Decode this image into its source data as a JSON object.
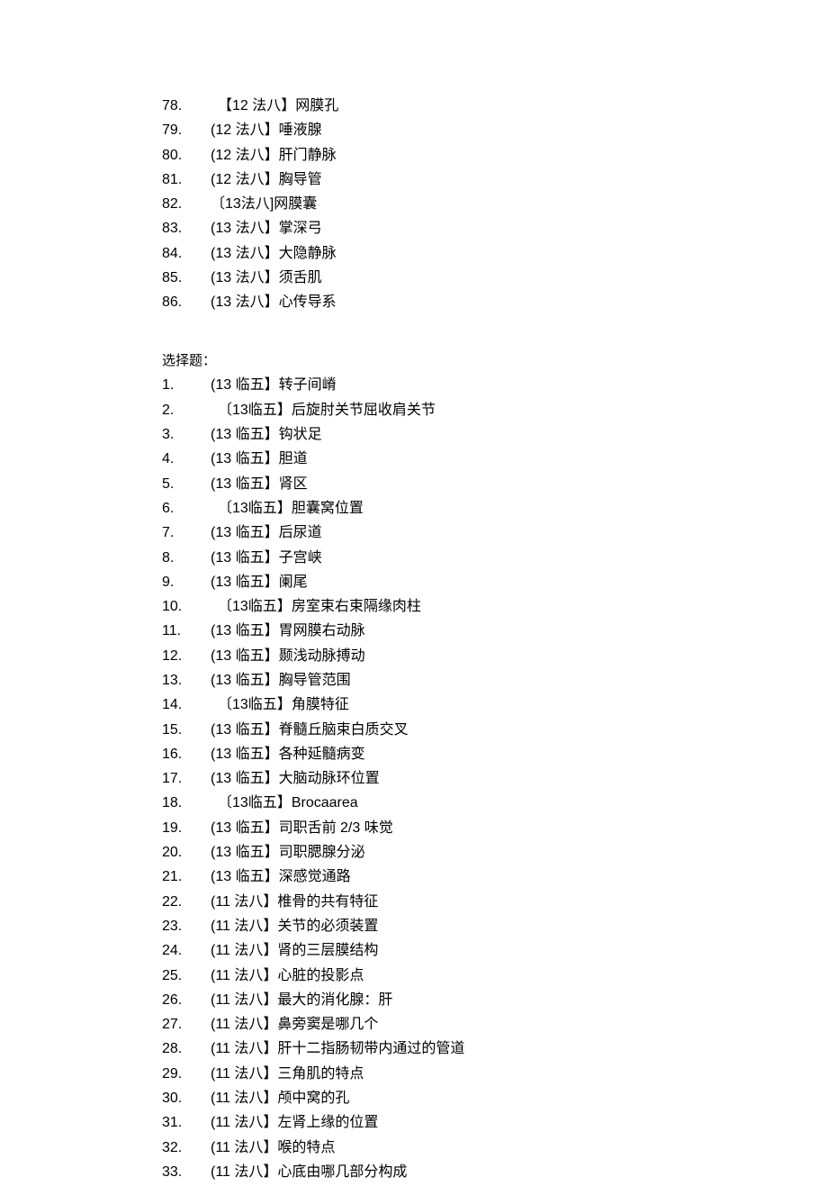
{
  "topList": [
    {
      "num": "78.",
      "tag": "【12 法八】",
      "text": "网膜孔",
      "indent": "indent-sm"
    },
    {
      "num": "79.",
      "tag": "(12 法八】",
      "text": "唾液腺"
    },
    {
      "num": "80.",
      "tag": "(12 法八】",
      "text": "肝门静脉"
    },
    {
      "num": "81.",
      "tag": "(12 法八】",
      "text": "胸导管"
    },
    {
      "num": "82.",
      "tag": "〔13法八]",
      "text": "网膜囊"
    },
    {
      "num": "83.",
      "tag": "(13 法八】",
      "text": "掌深弓"
    },
    {
      "num": "84.",
      "tag": "(13 法八】",
      "text": "大隐静脉"
    },
    {
      "num": "85.",
      "tag": "(13 法八】",
      "text": "须舌肌"
    },
    {
      "num": "86.",
      "tag": "(13 法八】",
      "text": "心传导系"
    }
  ],
  "sectionTitle": "选择题：",
  "bottomList": [
    {
      "num": "1.",
      "tag": "(13 临五】",
      "text": "转子间嵴"
    },
    {
      "num": "2.",
      "tag": "〔13临五】",
      "text": "后旋肘关节屈收肩关节",
      "indent": "indent-sm"
    },
    {
      "num": "3.",
      "tag": "(13 临五】",
      "text": "钩状足"
    },
    {
      "num": "4.",
      "tag": "(13 临五】",
      "text": "胆道"
    },
    {
      "num": "5.",
      "tag": "(13 临五】",
      "text": "肾区"
    },
    {
      "num": "6.",
      "tag": "〔13临五】",
      "text": "胆囊窝位置",
      "indent": "indent-sm"
    },
    {
      "num": "7.",
      "tag": "(13 临五】",
      "text": "后尿道"
    },
    {
      "num": "8.",
      "tag": "(13 临五】",
      "text": "子宫峡"
    },
    {
      "num": "9.",
      "tag": "(13 临五】",
      "text": "阑尾"
    },
    {
      "num": "10.",
      "tag": "〔13临五】",
      "text": "房室束右束隔缘肉柱",
      "indent": "indent-sm"
    },
    {
      "num": "11.",
      "tag": "(13 临五】",
      "text": "胃网膜右动脉"
    },
    {
      "num": "12.",
      "tag": "(13 临五】",
      "text": "颞浅动脉搏动"
    },
    {
      "num": "13.",
      "tag": "(13 临五】",
      "text": "胸导管范围"
    },
    {
      "num": "14.",
      "tag": "〔13临五】",
      "text": "角膜特征",
      "indent": "indent-sm"
    },
    {
      "num": "15.",
      "tag": "(13 临五】",
      "text": "脊髓丘脑束白质交叉"
    },
    {
      "num": "16.",
      "tag": "(13 临五】",
      "text": "各种延髓病变"
    },
    {
      "num": "17.",
      "tag": "(13 临五】",
      "text": "大脑动脉环位置"
    },
    {
      "num": "18.",
      "tag": "〔13临五】",
      "text": "Brocaarea",
      "indent": "indent-sm"
    },
    {
      "num": "19.",
      "tag": "(13 临五】",
      "text": "司职舌前 2/3 味觉"
    },
    {
      "num": "20.",
      "tag": "(13 临五】",
      "text": "司职腮腺分泌"
    },
    {
      "num": "21.",
      "tag": "(13 临五】",
      "text": "深感觉通路"
    },
    {
      "num": "22.",
      "tag": "(11 法八】",
      "text": "椎骨的共有特征"
    },
    {
      "num": "23.",
      "tag": "(11 法八】",
      "text": "关节的必须装置"
    },
    {
      "num": "24.",
      "tag": "(11 法八】",
      "text": "肾的三层膜结构"
    },
    {
      "num": "25.",
      "tag": "(11 法八】",
      "text": "心脏的投影点"
    },
    {
      "num": "26.",
      "tag": "(11 法八】",
      "text": "最大的消化腺：肝"
    },
    {
      "num": "27.",
      "tag": "(11 法八】",
      "text": "鼻旁窦是哪几个"
    },
    {
      "num": "28.",
      "tag": "(11 法八】",
      "text": "肝十二指肠韧带内通过的管道"
    },
    {
      "num": "29.",
      "tag": "(11 法八】",
      "text": "三角肌的特点"
    },
    {
      "num": "30.",
      "tag": "(11 法八】",
      "text": "颅中窝的孔"
    },
    {
      "num": "31.",
      "tag": "(11 法八】",
      "text": "左肾上缘的位置"
    },
    {
      "num": "32.",
      "tag": "(11 法八】",
      "text": "喉的特点"
    },
    {
      "num": "33.",
      "tag": "(11 法八】",
      "text": "心底由哪几部分构成"
    }
  ]
}
